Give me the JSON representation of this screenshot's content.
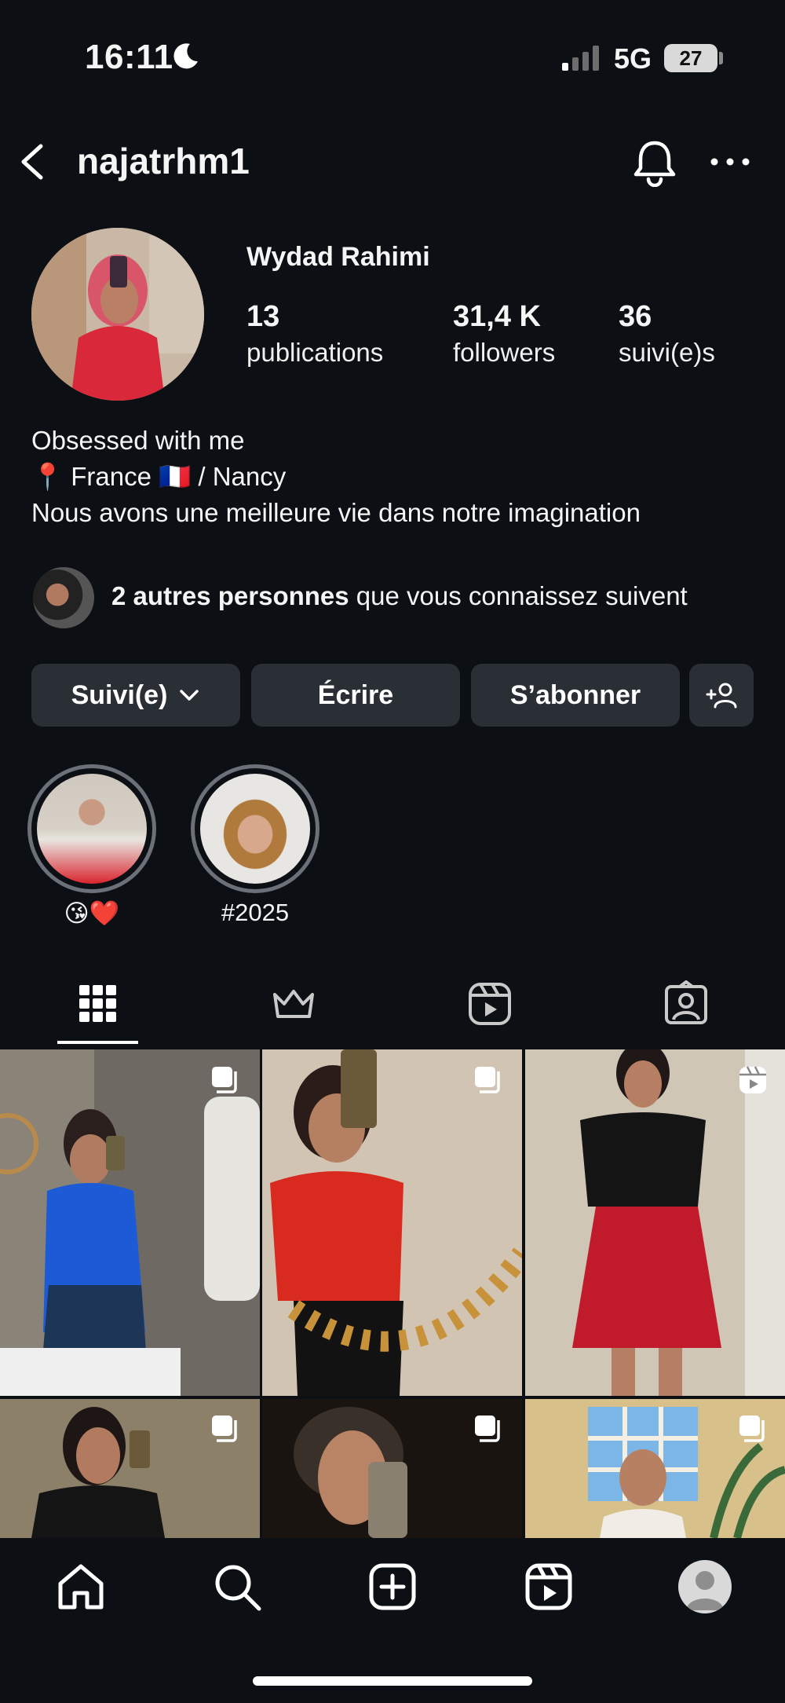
{
  "status_bar": {
    "time": "16:11",
    "network": "5G",
    "battery": "27"
  },
  "header": {
    "username": "najatrhm1"
  },
  "profile": {
    "display_name": "Wydad Rahimi",
    "stats": [
      {
        "value": "13",
        "label": "publications"
      },
      {
        "value": "31,4 K",
        "label": "followers"
      },
      {
        "value": "36",
        "label": "suivi(e)s"
      }
    ],
    "bio": [
      "Obsessed with me",
      "📍 France 🇫🇷 / Nancy",
      "Nous avons une meilleure vie dans notre imagination"
    ],
    "mutual": {
      "bold": "2 autres personnes",
      "rest": " que vous connaissez suivent"
    }
  },
  "actions": {
    "following": "Suivi(e)",
    "message": "Écrire",
    "subscribe": "S’abonner"
  },
  "highlights": [
    {
      "label": "😘❤️"
    },
    {
      "label": "#2025"
    }
  ],
  "tabs": [
    {
      "icon": "grid-icon",
      "active": true
    },
    {
      "icon": "crown-icon",
      "active": false
    },
    {
      "icon": "reels-icon",
      "active": false
    },
    {
      "icon": "tagged-icon",
      "active": false
    }
  ],
  "grid": [
    {
      "badge": "carousel-icon"
    },
    {
      "badge": "carousel-icon"
    },
    {
      "badge": "reel-icon"
    },
    {
      "badge": "carousel-icon"
    },
    {
      "badge": "carousel-icon"
    },
    {
      "badge": "carousel-icon"
    }
  ],
  "bottom_nav": [
    "home-icon",
    "search-icon",
    "create-icon",
    "reels-icon",
    "profile-avatar"
  ]
}
